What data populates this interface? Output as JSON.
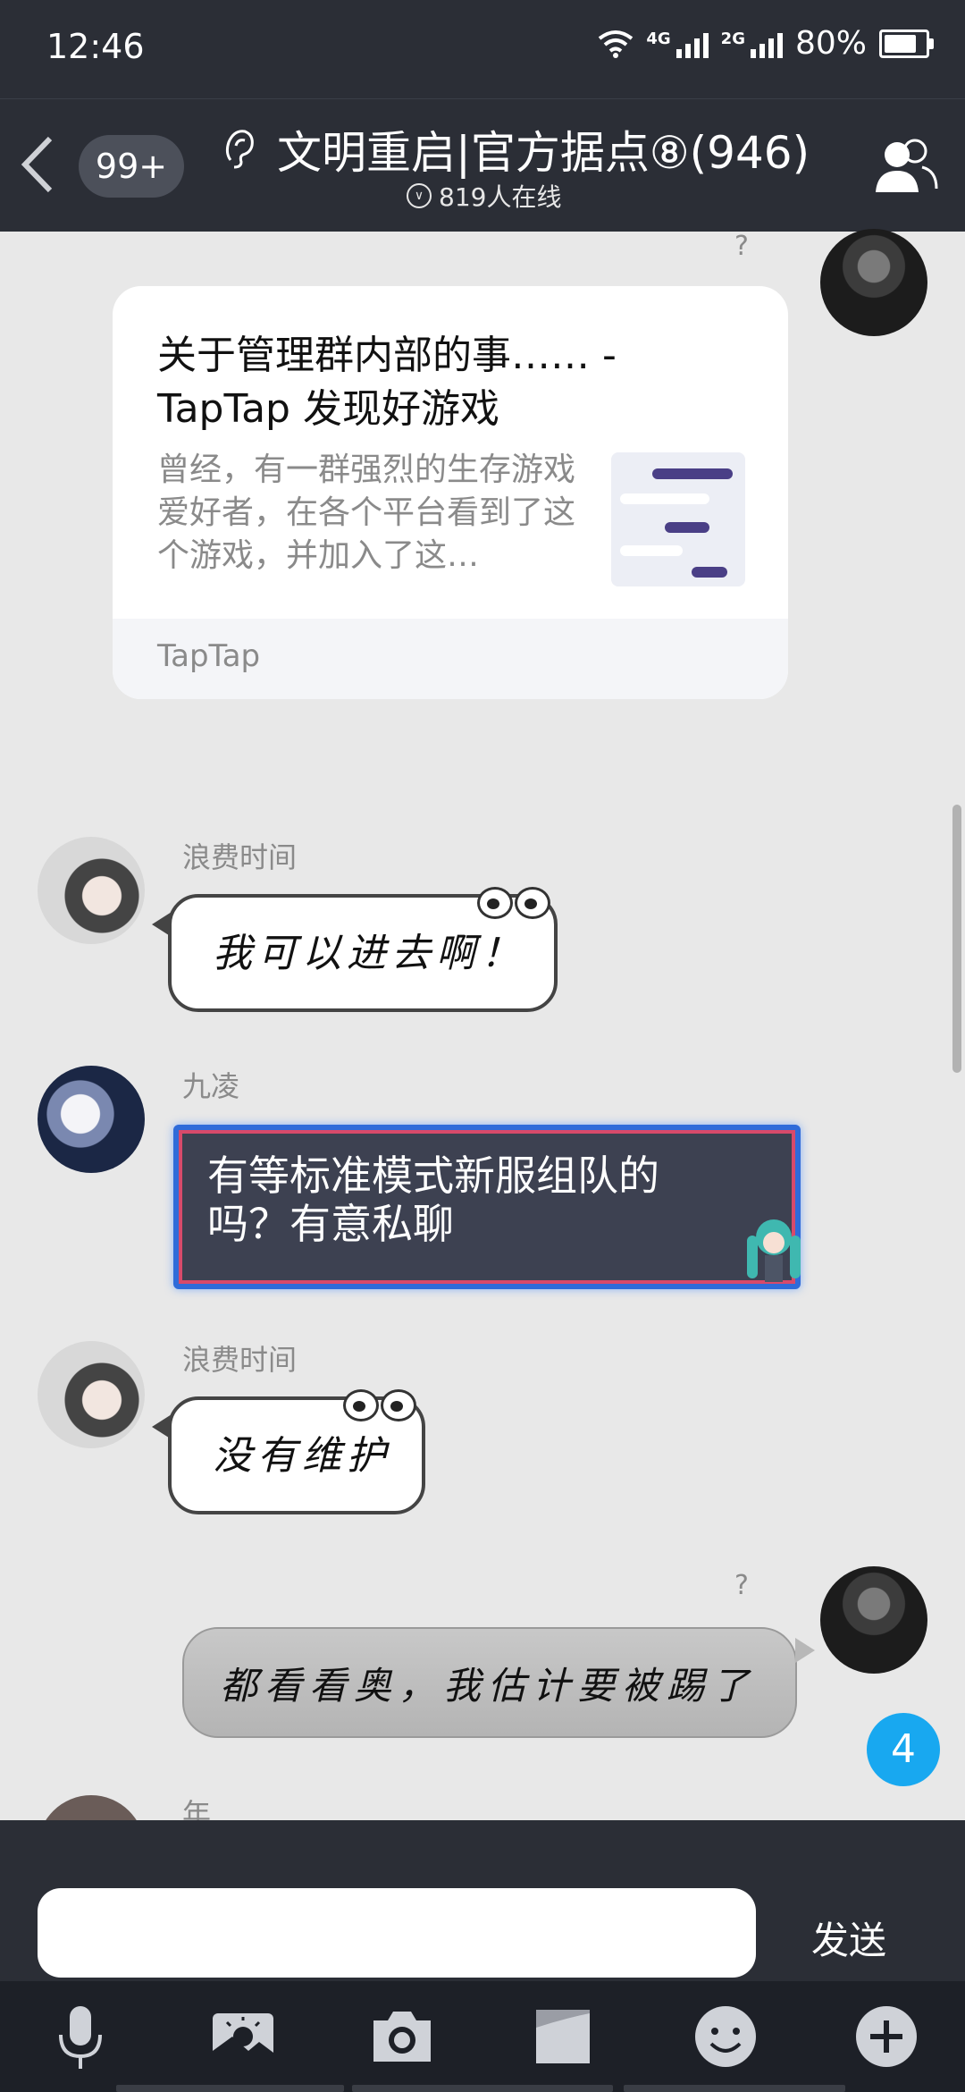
{
  "status_bar": {
    "time": "12:46",
    "network_4g": "4G",
    "network_2g": "2G",
    "battery": "80%",
    "battery_level": 0.8
  },
  "header": {
    "back_icon": "chevron-left-icon",
    "unread_badge": "99+",
    "ear_icon": "ear-icon",
    "title": "文明重启|官方据点⑧(946)",
    "online": "819人在线",
    "members_icon": "group-members-icon"
  },
  "messages": {
    "m1": {
      "question": "?",
      "card_title": "关于管理群内部的事…… - TapTap 发现好游戏",
      "card_desc": "曾经，有一群强烈的生存游戏爱好者，在各个平台看到了这个游戏，并加入了这…",
      "card_source": "TapTap"
    },
    "m2": {
      "sender": "浪费时间",
      "text": "我可以进去啊！"
    },
    "m3": {
      "sender": "九凌",
      "text": "有等标准模式新服组队的吗？有意私聊"
    },
    "m4": {
      "sender": "浪费时间",
      "text": "没有维护"
    },
    "m5": {
      "question": "?",
      "text": "都看看奥，我估计要被踢了"
    },
    "m6": {
      "sender": "年"
    }
  },
  "unread_count": "4",
  "input": {
    "value": "",
    "placeholder": "",
    "send_label": "发送"
  },
  "toolbar": [
    "microphone-icon",
    "image-icon",
    "camera-icon",
    "folder-icon",
    "emoji-icon",
    "plus-icon"
  ],
  "colors": {
    "header_bg": "#2b2e36",
    "chat_bg": "#e8e8e8",
    "unread_badge": "#18a8f0"
  }
}
